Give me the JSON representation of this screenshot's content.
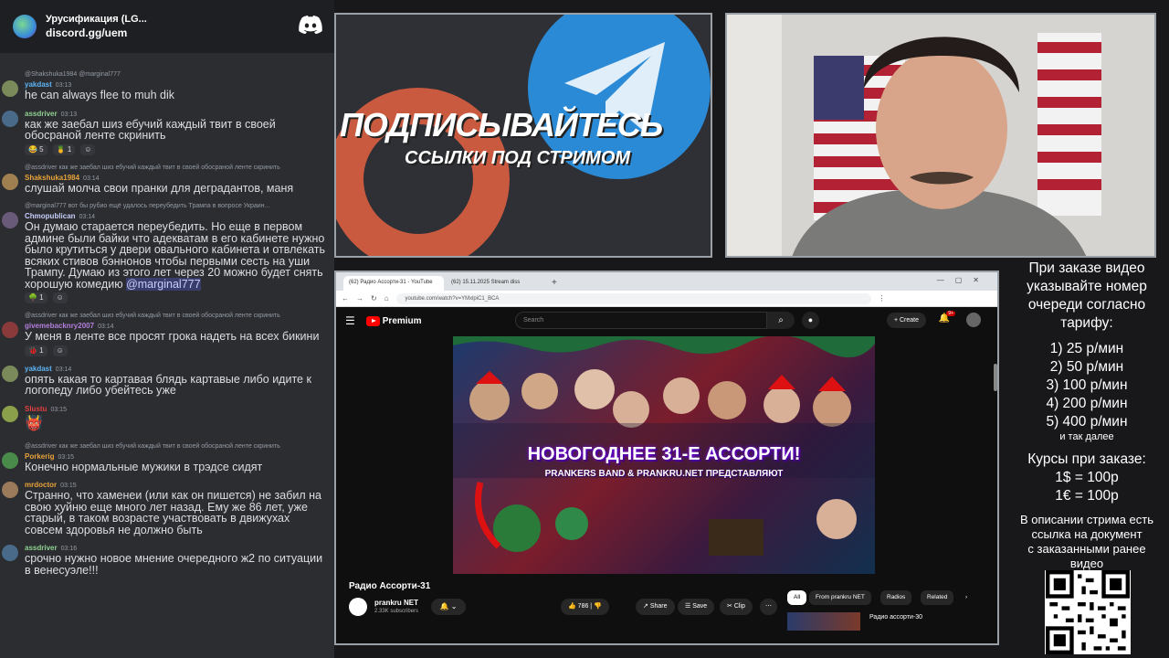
{
  "discord": {
    "server_name": "Урусификация (LG...",
    "server_link": "discord.gg/uem"
  },
  "messages": [
    {
      "reply": "@Shakshuka1984 @marginal777",
      "user": "yakdast",
      "user_color": "#5fb3f5",
      "time": "03:13",
      "text": "he can always flee to muh dik",
      "avatar_color": "#7a8a5a"
    },
    {
      "reply": "",
      "user": "assdriver",
      "user_color": "#8fd18f",
      "time": "03:13",
      "text": "как же заебал шиз ебучий каждый твит в своей обосраной ленте скринить",
      "avatar_color": "#4a6a8a",
      "reactions": [
        "😂 5",
        "🍍 1",
        "☺"
      ]
    },
    {
      "reply": "@assdriver как же заебал шиз ебучий каждый твит в своей обосраной ленте скринить",
      "user": "Shakshuka1984",
      "user_color": "#e8a33a",
      "time": "03:14",
      "text": "слушай молча свои пранки для деградантов, маня",
      "avatar_color": "#a08050"
    },
    {
      "reply": "@marginal777 вот бы рубио ещё удалось переубедить Трампа в вопросе Украин...",
      "user": "Chmopublican",
      "user_color": "#c9cdfb",
      "time": "03:14",
      "text": "Он думаю старается переубедить. Но еще в первом админе были байки что адекватам в его кабинете нужно было крутиться у двери овального кабинета и отвлекать всяких стивов бэннонов чтобы первыми сесть на уши Трампу. Думаю из этого лет через 20 можно будет снять хорошую комедию",
      "mention": "@marginal777",
      "avatar_color": "#6a5a7a",
      "reactions": [
        "🌳 1",
        "☺"
      ]
    },
    {
      "reply": "@assdriver как же заебал шиз ебучий каждый твит в своей обосраной ленте скринить",
      "user": "givemebacknry2007",
      "user_color": "#b57edc",
      "time": "03:14",
      "text": "У меня в ленте все просят грока надеть на всех бикини",
      "avatar_color": "#8a3a3a",
      "reactions": [
        "🐞 1",
        "☺"
      ]
    },
    {
      "reply": "",
      "user": "yakdast",
      "user_color": "#5fb3f5",
      "time": "03:14",
      "text": "опять какая то картавая блядь картавые либо идите к логопеду либо убейтесь уже",
      "avatar_color": "#7a8a5a"
    },
    {
      "reply": "",
      "user": "Slustu",
      "user_color": "#e04040",
      "time": "03:15",
      "text": "",
      "emoji": "👹",
      "avatar_color": "#8aa04a"
    },
    {
      "reply": "@assdriver как же заебал шиз ебучий каждый твит в своей обосраной ленте скринить",
      "user": "Porkerig",
      "user_color": "#e8a33a",
      "time": "03:15",
      "text": "Конечно нормальные мужики в трэдсе сидят",
      "avatar_color": "#4a8a4a"
    },
    {
      "reply": "",
      "user": "mrdoctor",
      "user_color": "#e8a33a",
      "time": "03:15",
      "text": "Странно, что хаменеи (или как он пишется) не забил на свою хуйню еще много лет назад. Ему же 86 лет, уже старый, в таком возрасте участвовать в движухах совсем здоровья не должно быть",
      "avatar_color": "#9a7a5a"
    },
    {
      "reply": "",
      "user": "assdriver",
      "user_color": "#8fd18f",
      "time": "03:16",
      "text": "срочно нужно новое мнение очередного ж2 по ситуации в венесуэле!!!",
      "avatar_color": "#4a6a8a"
    }
  ],
  "promo": {
    "title": "ПОДПИСЫВАЙТЕСЬ",
    "subtitle": "ССЫЛКИ ПОД СТРИМОМ"
  },
  "browser": {
    "tab1": "(62) Радио Ассорти-31 - YouTube",
    "tab2": "(62) 15.11.2025 Stream diss",
    "url": "youtube.com/watch?v=YMxlpiC1_BCA",
    "brand": "Premium",
    "search_placeholder": "Search",
    "create": "+ Create",
    "notif": "9+",
    "video_title_overlay": "НОВОГОДНЕЕ 31-Е АССОРТИ!",
    "video_sub_overlay": "PRANKERS BAND & PRANKRU.NET ПРЕДСТАВЛЯЮТ",
    "video_name": "Радио Ассорти-31",
    "channel": "prankru NET",
    "subs": "2.33K subscribers",
    "likes": "786",
    "share": "Share",
    "save": "Save",
    "clip": "Clip",
    "chips": [
      "All",
      "From prankru NET",
      "Radios",
      "Related"
    ],
    "related_title": "Радио ассорти-30"
  },
  "info": {
    "lines": [
      "При заказе видео",
      "указывайте номер",
      "очереди согласно",
      "тарифу:"
    ],
    "tariffs": [
      "1) 25 р/мин",
      "2) 50 р/мин",
      "3) 100 р/мин",
      "4) 200 р/мин",
      "5) 400 р/мин"
    ],
    "etc": "и так далее",
    "rates_title": "Курсы при заказе:",
    "rate1": "1$ = 100р",
    "rate2": "1€ = 100р",
    "desc": [
      "В описании стрима есть",
      "ссылка на документ",
      "с заказанными ранее",
      "видео"
    ]
  }
}
